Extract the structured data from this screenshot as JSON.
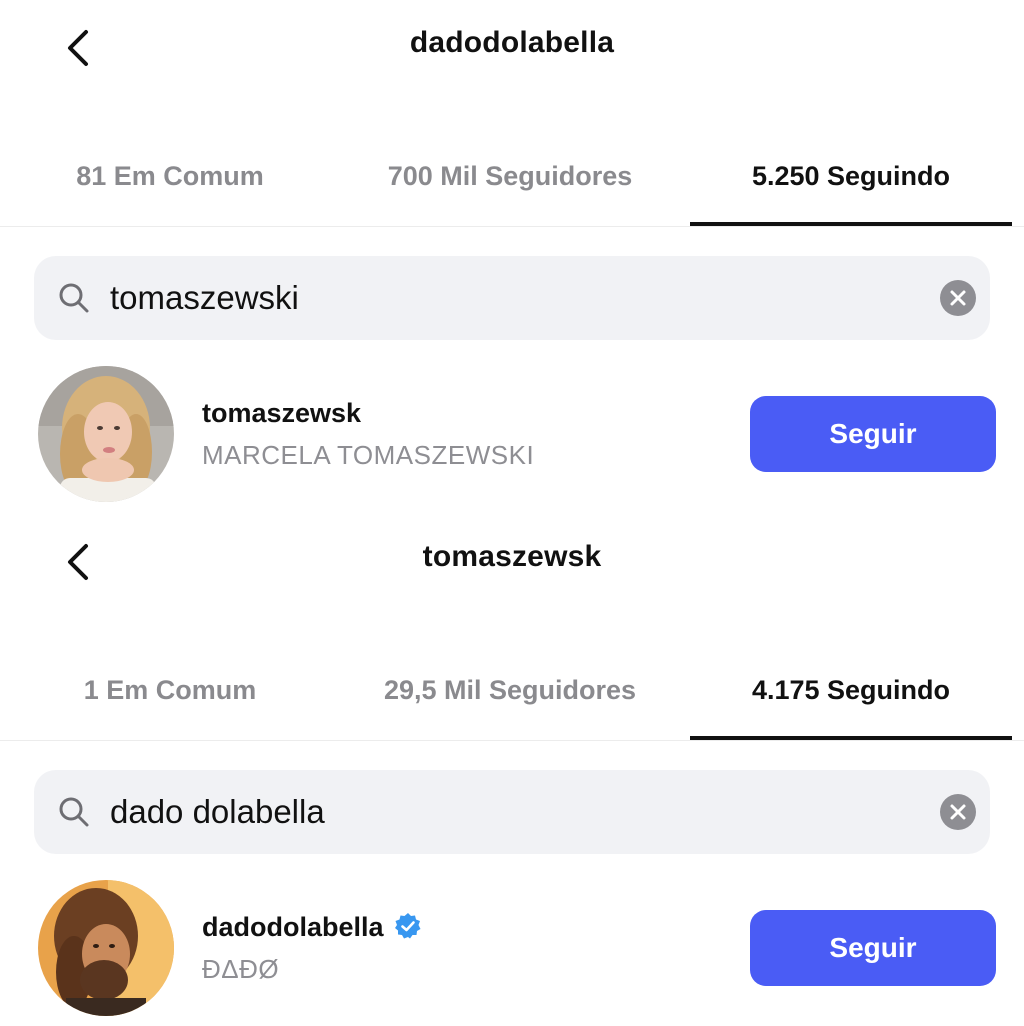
{
  "screens": [
    {
      "header": {
        "title": "dadodolabella"
      },
      "tabs": [
        {
          "label": "81 Em Comum",
          "active": false
        },
        {
          "label": "700 Mil Seguidores",
          "active": false
        },
        {
          "label": "5.250 Seguindo",
          "active": true
        }
      ],
      "search": {
        "value": "tomaszewski"
      },
      "result": {
        "username": "tomaszewsk",
        "full_name": "MARCELA TOMASZEWSKI",
        "verified": false,
        "button_label": "Seguir"
      }
    },
    {
      "header": {
        "title": "tomaszewsk"
      },
      "tabs": [
        {
          "label": "1 Em Comum",
          "active": false
        },
        {
          "label": "29,5 Mil Seguidores",
          "active": false
        },
        {
          "label": "4.175 Seguindo",
          "active": true
        }
      ],
      "search": {
        "value": "dado dolabella"
      },
      "result": {
        "username": "dadodolabella",
        "full_name": "ÐΔÐØ",
        "verified": true,
        "button_label": "Seguir"
      }
    }
  ],
  "icons": {
    "back": "chevron-left-icon",
    "search": "search-icon",
    "clear": "clear-x-icon",
    "verified": "verified-badge-icon"
  },
  "colors": {
    "follow_button": "#4a5cf5",
    "search_bg": "#f1f2f5",
    "inactive_tab": "#8a8a8e",
    "verified": "#3897f0"
  }
}
